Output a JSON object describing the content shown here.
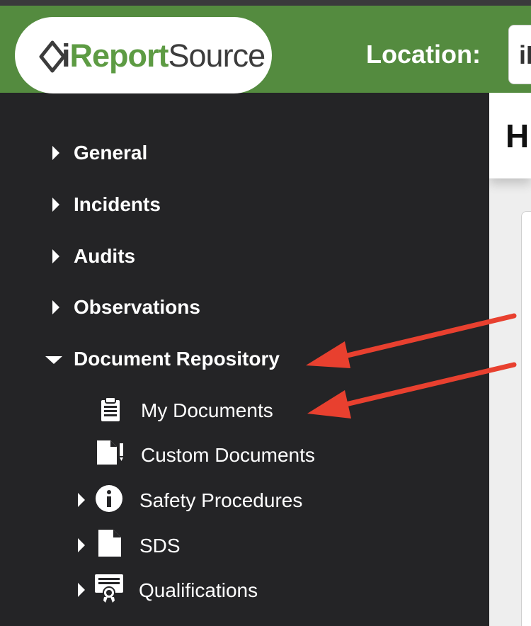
{
  "header": {
    "logo": {
      "prefix": "i",
      "middle": "Report",
      "suffix": "Source"
    },
    "location_label": "Location:",
    "location_value": "iI",
    "brand_color": "#548b3f"
  },
  "page": {
    "title": "H"
  },
  "sidebar": {
    "items": [
      {
        "label": "General",
        "expanded": false
      },
      {
        "label": "Incidents",
        "expanded": false
      },
      {
        "label": "Audits",
        "expanded": false
      },
      {
        "label": "Observations",
        "expanded": false
      },
      {
        "label": "Document Repository",
        "expanded": true
      }
    ],
    "subitems": [
      {
        "label": "My Documents",
        "icon": "clipboard-icon"
      },
      {
        "label": "Custom Documents",
        "icon": "document-edit-icon"
      },
      {
        "label": "Safety Procedures",
        "icon": "info-icon",
        "expandable": true
      },
      {
        "label": "SDS",
        "icon": "file-icon",
        "expandable": true
      },
      {
        "label": "Qualifications",
        "icon": "certificate-icon",
        "expandable": true
      }
    ]
  },
  "annotations": {
    "arrow_color": "#e8402f"
  }
}
